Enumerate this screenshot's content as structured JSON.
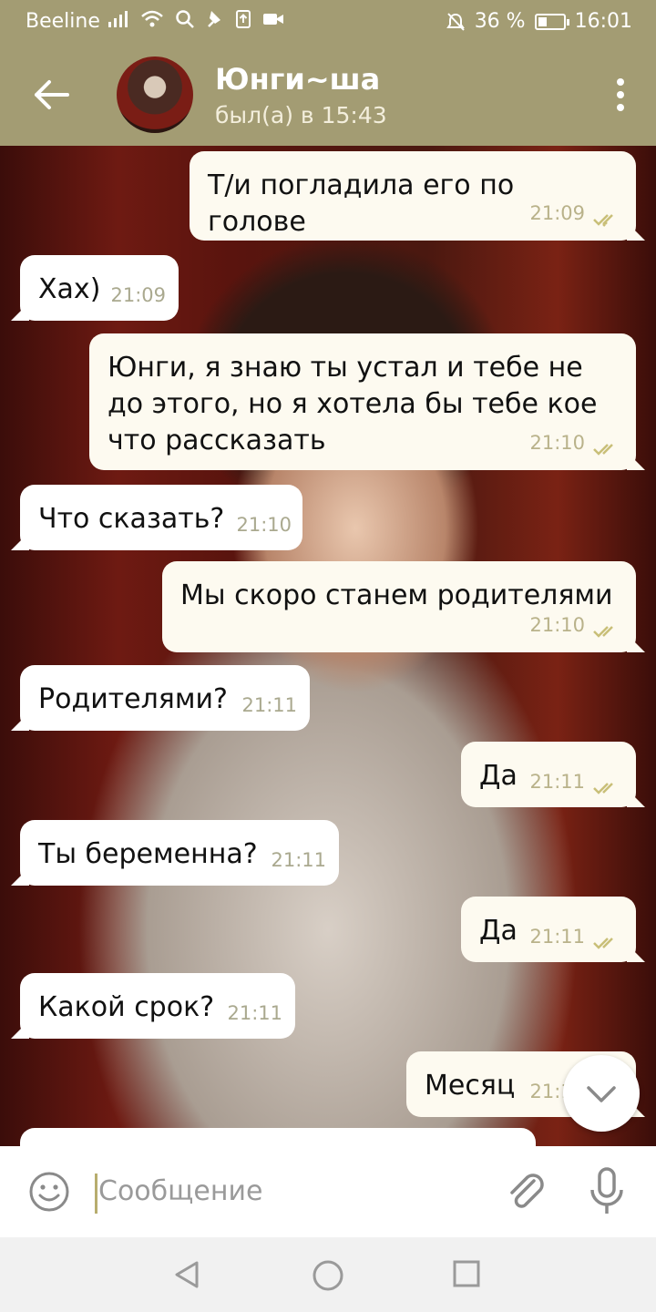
{
  "status_bar": {
    "carrier": "Beeline",
    "battery": "36 %",
    "battery_level": 0.36,
    "time": "16:01"
  },
  "header": {
    "title": "Юнги~ша",
    "subtitle": "был(а) в 15:43"
  },
  "messages": [
    {
      "direction": "out",
      "text": "Т/и погладила его по голове",
      "time": "21:09"
    },
    {
      "direction": "in",
      "text": "Хах)",
      "time": "21:09"
    },
    {
      "direction": "out",
      "text": "Юнги, я знаю ты устал и тебе не до этого, но я хотела бы тебе кое что рассказать",
      "time": "21:10"
    },
    {
      "direction": "in",
      "text": "Что сказать?",
      "time": "21:10"
    },
    {
      "direction": "out",
      "text": "Мы скоро станем родителями",
      "time": "21:10"
    },
    {
      "direction": "in",
      "text": "Родителями?",
      "time": "21:11"
    },
    {
      "direction": "out",
      "text": "Да",
      "time": "21:11"
    },
    {
      "direction": "in",
      "text": "Ты беременна?",
      "time": "21:11"
    },
    {
      "direction": "out",
      "text": "Да",
      "time": "21:11"
    },
    {
      "direction": "in",
      "text": "Какой срок?",
      "time": "21:11"
    },
    {
      "direction": "out",
      "text": "Месяц",
      "time": "21:11"
    }
  ],
  "input": {
    "placeholder": "Сообщение"
  },
  "colors": {
    "header": "#a39c73",
    "outgoing_bubble": "#fdfaf0",
    "incoming_bubble": "#ffffff",
    "read_ticks": "#c9bf78"
  },
  "icons": [
    "back-arrow-icon",
    "more-vert-icon",
    "emoji-icon",
    "attach-icon",
    "mic-icon",
    "chevron-down-icon",
    "nav-back-icon",
    "nav-home-icon",
    "nav-recents-icon",
    "double-check-icon"
  ]
}
